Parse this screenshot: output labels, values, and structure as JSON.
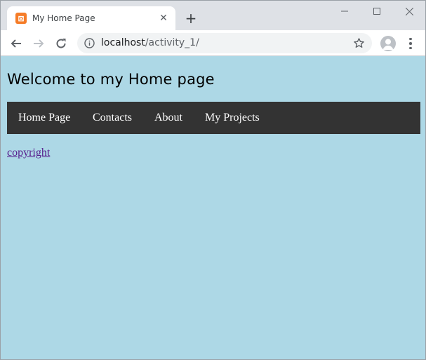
{
  "browser": {
    "tab": {
      "title": "My Home Page",
      "favicon": "xampp-icon",
      "close": "✕"
    },
    "new_tab": "+",
    "window_controls": [
      "minimize-icon",
      "maximize-icon",
      "close-icon"
    ],
    "address": {
      "host": "localhost",
      "path": "/activity_1/"
    }
  },
  "page": {
    "background": "#add8e6",
    "heading": "Welcome to my Home page",
    "nav": {
      "background": "#333333",
      "links": [
        "Home Page",
        "Contacts",
        "About",
        "My Projects"
      ]
    },
    "footer_link": "copyright"
  }
}
